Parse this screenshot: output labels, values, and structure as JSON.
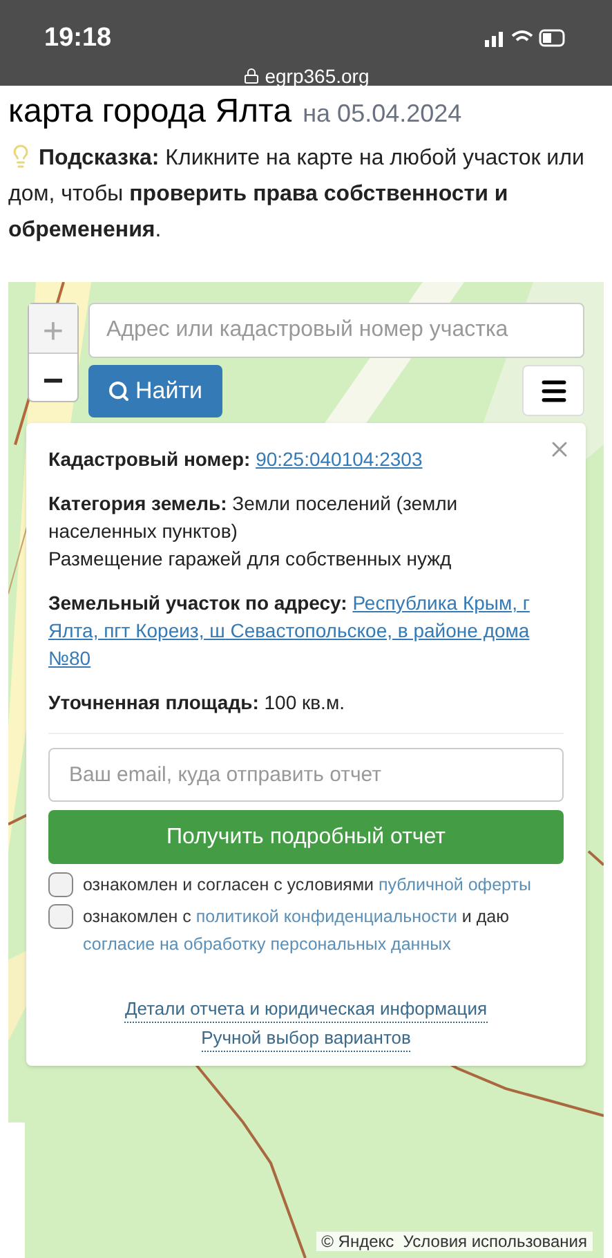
{
  "status_bar": {
    "time": "19:18",
    "url": "egrp365.org"
  },
  "page": {
    "title": "карта города Ялта",
    "date": "на 05.04.2024"
  },
  "hint": {
    "label": "Подсказка:",
    "text": "Кликните на карте на любой участок или дом, чтобы **проверить права собственности и обременения**."
  },
  "map": {
    "zoom_in": "+",
    "zoom_out": "−",
    "search": {
      "placeholder": "Адрес или кадастровый номер участка"
    },
    "find_button": "Найти",
    "popup": {
      "fields": [
        {
          "kind": "link",
          "label": "Кадастровый номер:",
          "value": "90:25:040104:2303"
        },
        {
          "kind": "text",
          "label": "Категория земель:",
          "value": "Земли поселений (земли населенных пунктов)",
          "note": "Размещение гаражей для собственных нужд"
        },
        {
          "kind": "link",
          "label": "Земельный участок по адресу:",
          "value": "Республика Крым, г Ялта, пгт Кореиз, ш Севастопольское, в районе дома №80"
        },
        {
          "kind": "text",
          "label": "Уточненная площадь:",
          "value": "100 кв.м."
        }
      ],
      "email": {
        "placeholder": "Ваш email, куда отправить отчет"
      },
      "submit": "Получить подробный отчет",
      "agreements": [
        {
          "checked": false,
          "parts": [
            {
              "kind": "text",
              "text": "ознакомлен и согласен с условиями "
            },
            {
              "kind": "link",
              "text": "публичной оферты"
            }
          ]
        },
        {
          "checked": false,
          "parts": [
            {
              "kind": "text",
              "text": "ознакомлен с "
            },
            {
              "kind": "link",
              "text": "политикой конфиденциальности"
            },
            {
              "kind": "text",
              "text": " и даю "
            },
            {
              "kind": "link",
              "text": "согласие на обработку персональных данных"
            }
          ]
        }
      ],
      "links": [
        "Детали отчета и юридическая информация",
        "Ручной выбор вариантов"
      ]
    },
    "attribution": "© Яндекс  Условия использования"
  }
}
